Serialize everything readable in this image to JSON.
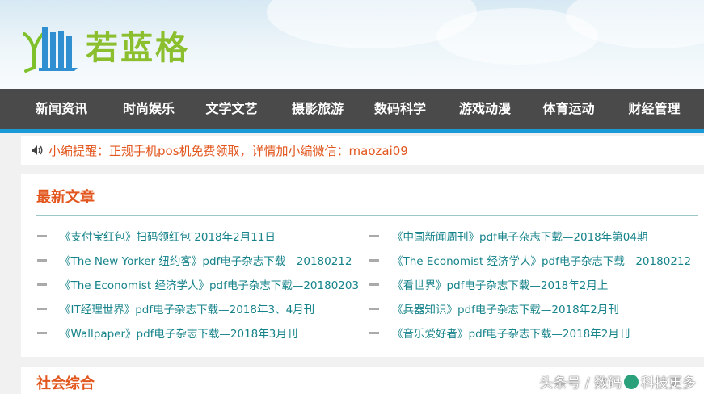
{
  "site": {
    "logo_text": "若蓝格"
  },
  "nav": {
    "items": [
      "新闻资讯",
      "时尚娱乐",
      "文学文艺",
      "摄影旅游",
      "数码科学",
      "游戏动漫",
      "体育运动",
      "财经管理"
    ]
  },
  "notice": {
    "text": "小编提醒：正规手机pos机免费领取，详情加小编微信：maozai09"
  },
  "latest": {
    "title": "最新文章",
    "articles": [
      "《支付宝红包》扫码领红包 2018年2月11日",
      "《中国新闻周刊》pdf电子杂志下载—2018年第04期",
      "《The New Yorker 纽约客》pdf电子杂志下载—20180212",
      "《The Economist 经济学人》pdf电子杂志下载—20180212",
      "《The Economist 经济学人》pdf电子杂志下载—20180203",
      "《看世界》pdf电子杂志下载—2018年2月上",
      "《IT经理世界》pdf电子杂志下载—2018年3、4月刊",
      "《兵器知识》pdf电子杂志下载—2018年2月刊",
      "《Wallpaper》pdf电子杂志下载—2018年3月刊",
      "《音乐爱好者》pdf电子杂志下载—2018年2月刊"
    ]
  },
  "section2": {
    "title": "社会综合"
  },
  "watermark": {
    "prefix": "头条号 / 数码",
    "suffix": "科技更多"
  },
  "colors": {
    "nav_bg": "#4a4a4a",
    "nav_accent": "#1a9ad6",
    "title_orange": "#e2561d",
    "link_teal": "#16838a",
    "logo_green": "#8cbf2e"
  }
}
